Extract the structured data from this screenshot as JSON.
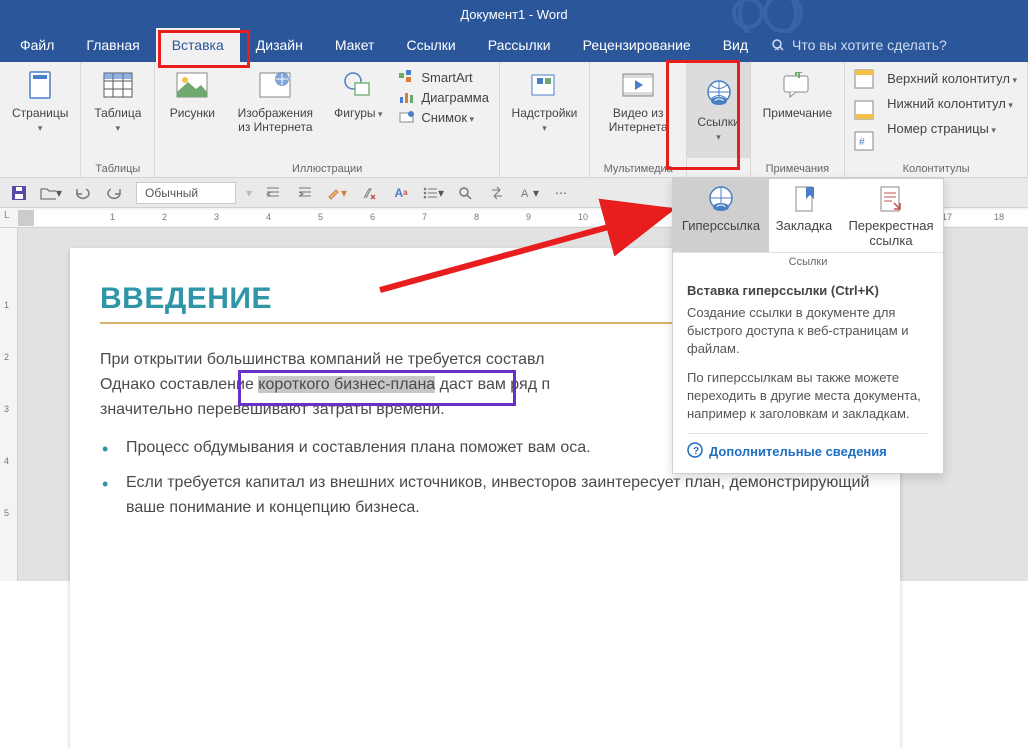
{
  "title": "Документ1 - Word",
  "tabs": {
    "file": "Файл",
    "home": "Главная",
    "insert": "Вставка",
    "design": "Дизайн",
    "layout": "Макет",
    "refs": "Ссылки",
    "mail": "Рассылки",
    "review": "Рецензирование",
    "view": "Вид"
  },
  "tell_me": "Что вы хотите сделать?",
  "ribbon": {
    "pages": {
      "btn": "Страницы",
      "label": ""
    },
    "tables": {
      "btn": "Таблица",
      "label": "Таблицы"
    },
    "illustr": {
      "pic": "Рисунки",
      "online": "Изображения из Интернета",
      "shapes": "Фигуры",
      "smartart": "SmartArt",
      "chart": "Диаграмма",
      "screenshot": "Снимок",
      "label": "Иллюстрации"
    },
    "addins": {
      "btn": "Надстройки",
      "label": ""
    },
    "media": {
      "video": "Видео из Интернета",
      "label": "Мультимедиа"
    },
    "links": {
      "btn": "Ссылки",
      "label": ""
    },
    "comments": {
      "btn": "Примечание",
      "label": "Примечания"
    },
    "headers": {
      "header": "Верхний колонтитул",
      "footer": "Нижний колонтитул",
      "pagenum": "Номер страницы",
      "label": "Колонтитулы"
    }
  },
  "qat": {
    "style": "Обычный"
  },
  "ruler_unit": "L",
  "doc": {
    "heading": "ВВЕДЕНИЕ",
    "p1_a": "При открытии большинства компаний не требуется составл",
    "p1_b": "Однако составление ",
    "p1_sel": "короткого бизнес-плана",
    "p1_c": " даст вам ряд п",
    "p1_d": "значительно перевешивают затраты времени.",
    "b1": "Процесс обдумывания и составления плана поможет вам оса.",
    "b2": "Если требуется капитал из внешних источников, инвесторов заинтересует план, демонстрирующий ваше понимание и концепцию бизнеса."
  },
  "popup": {
    "hyperlink": "Гиперссылка",
    "bookmark": "Закладка",
    "crossref": "Перекрестная ссылка",
    "group": "Ссылки",
    "title": "Вставка гиперссылки (Ctrl+K)",
    "t1": "Создание ссылки в документе для быстрого доступа к веб-страницам и файлам.",
    "t2": "По гиперссылкам вы также можете переходить в другие места документа, например к заголовкам и закладкам.",
    "more": "Дополнительные сведения"
  }
}
